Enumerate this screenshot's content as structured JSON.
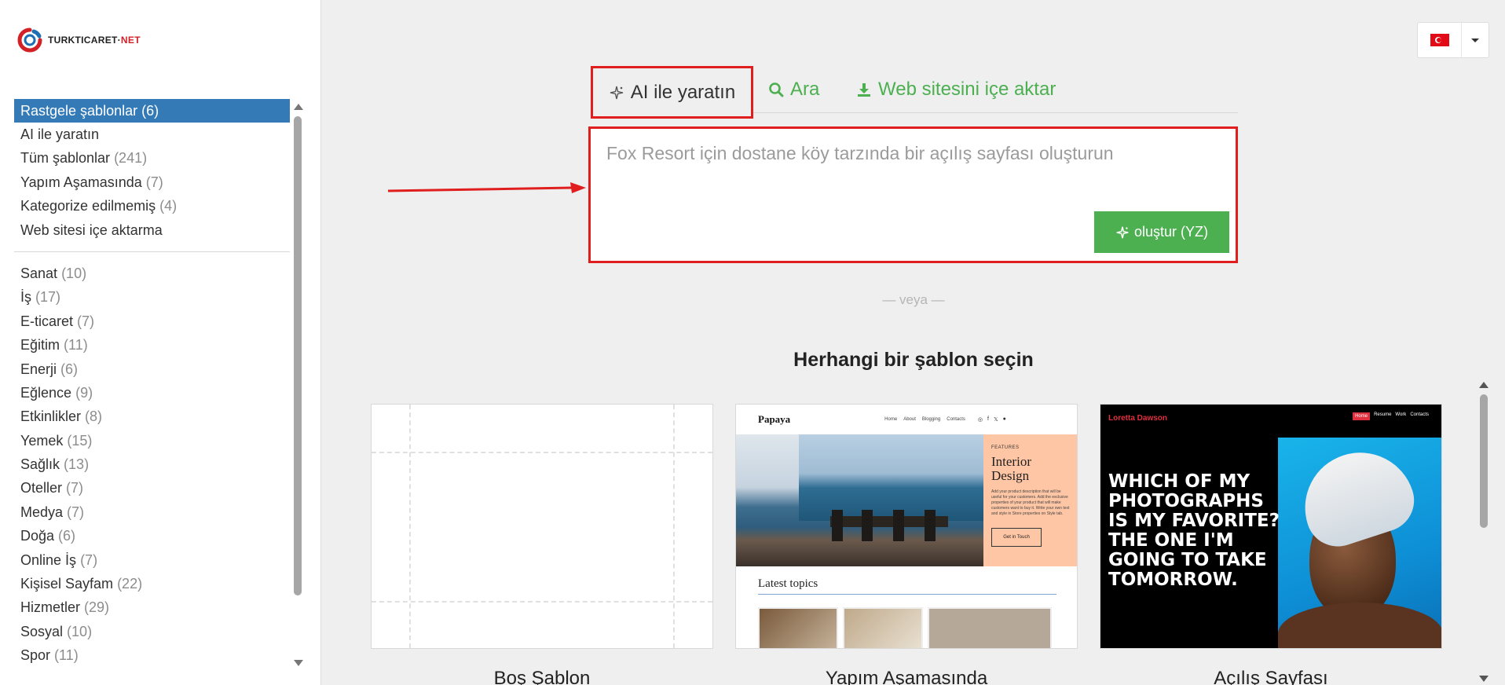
{
  "brand": {
    "logo_text_main": "TURKTICARET",
    "logo_text_sep": "·",
    "logo_text_suffix": "NET"
  },
  "colors": {
    "accent_green": "#4caf50",
    "active_blue": "#337ab7",
    "annotation_red": "#e01e1e"
  },
  "language": {
    "flag": "turkey-flag-icon"
  },
  "sidebar": {
    "primary": [
      {
        "label": "Rastgele şablonlar",
        "count": "(6)",
        "active": true
      },
      {
        "label": "AI ile yaratın",
        "count": ""
      },
      {
        "label": "Tüm şablonlar",
        "count": "(241)"
      },
      {
        "label": "Yapım Aşamasında",
        "count": "(7)"
      },
      {
        "label": "Kategorize edilmemiş",
        "count": "(4)"
      },
      {
        "label": "Web sitesi içe aktarma",
        "count": ""
      }
    ],
    "categories": [
      {
        "label": "Sanat",
        "count": "(10)"
      },
      {
        "label": "İş",
        "count": "(17)"
      },
      {
        "label": "E-ticaret",
        "count": "(7)"
      },
      {
        "label": "Eğitim",
        "count": "(11)"
      },
      {
        "label": "Enerji",
        "count": "(6)"
      },
      {
        "label": "Eğlence",
        "count": "(9)"
      },
      {
        "label": "Etkinlikler",
        "count": "(8)"
      },
      {
        "label": "Yemek",
        "count": "(15)"
      },
      {
        "label": "Sağlık",
        "count": "(13)"
      },
      {
        "label": "Oteller",
        "count": "(7)"
      },
      {
        "label": "Medya",
        "count": "(7)"
      },
      {
        "label": "Doğa",
        "count": "(6)"
      },
      {
        "label": "Online İş",
        "count": "(7)"
      },
      {
        "label": "Kişisel Sayfam",
        "count": "(22)"
      },
      {
        "label": "Hizmetler",
        "count": "(29)"
      },
      {
        "label": "Sosyal",
        "count": "(10)"
      },
      {
        "label": "Spor",
        "count": "(11)"
      }
    ]
  },
  "tabs": {
    "ai": "AI ile yaratın",
    "search": "Ara",
    "import": "Web sitesini içe aktar"
  },
  "prompt": {
    "placeholder": "Fox Resort için dostane köy tarzında bir açılış sayfası oluşturun",
    "button": "oluştur (YZ)"
  },
  "divider_text": "— veya —",
  "section_heading": "Herhangi bir şablon seçin",
  "templates": [
    {
      "name": "Boş Şablon"
    },
    {
      "name": "Yapım Aşamasında",
      "preview": {
        "brand": "Papaya",
        "links": [
          "Home",
          "About",
          "Blogging",
          "Contacts"
        ],
        "social": [
          "◎",
          "f",
          "𝕏",
          "●"
        ],
        "kicker": "FEATURES",
        "title": "Interior Design",
        "desc": "Add your product description that will be useful for your customers. Add the exclusive properties of your product that will make customers want to buy it. Write your own text and style in Store properties on Style tab.",
        "button": "Get in Touch",
        "latest": "Latest topics"
      }
    },
    {
      "name": "Açılış Sayfası",
      "preview": {
        "brand": "Loretta Dawson",
        "menu": [
          "Home",
          "Resume",
          "Work",
          "Contacts"
        ],
        "headline": "WHICH OF MY PHOTOGRAPHS IS MY FAVORITE? THE ONE I'M GOING TO TAKE TOMORROW."
      }
    }
  ]
}
